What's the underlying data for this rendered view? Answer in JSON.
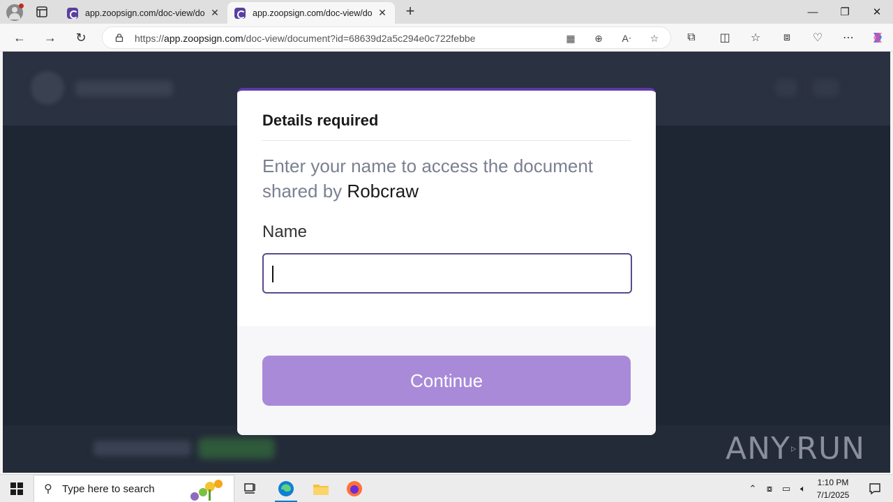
{
  "browser": {
    "tabs": [
      {
        "title": "app.zoopsign.com/doc-view/docu",
        "active": false
      },
      {
        "title": "app.zoopsign.com/doc-view/docu",
        "active": true
      }
    ],
    "new_tab_label": "+",
    "url_prefix": "https://",
    "url_host": "app.zoopsign.com",
    "url_path": "/doc-view/document?id=68639d2a5c294e0c722febbe"
  },
  "modal": {
    "title": "Details required",
    "description": "Enter your name to access the document shared by",
    "sender": "Robcraw",
    "name_label": "Name",
    "name_value": "",
    "continue_label": "Continue",
    "accent_color": "#5e3aa8",
    "button_color": "#a98ad9"
  },
  "watermark": {
    "text_left": "ANY",
    "text_right": "RUN"
  },
  "taskbar": {
    "search_placeholder": "Type here to search",
    "time": "1:10 PM",
    "date": "7/1/2025"
  }
}
